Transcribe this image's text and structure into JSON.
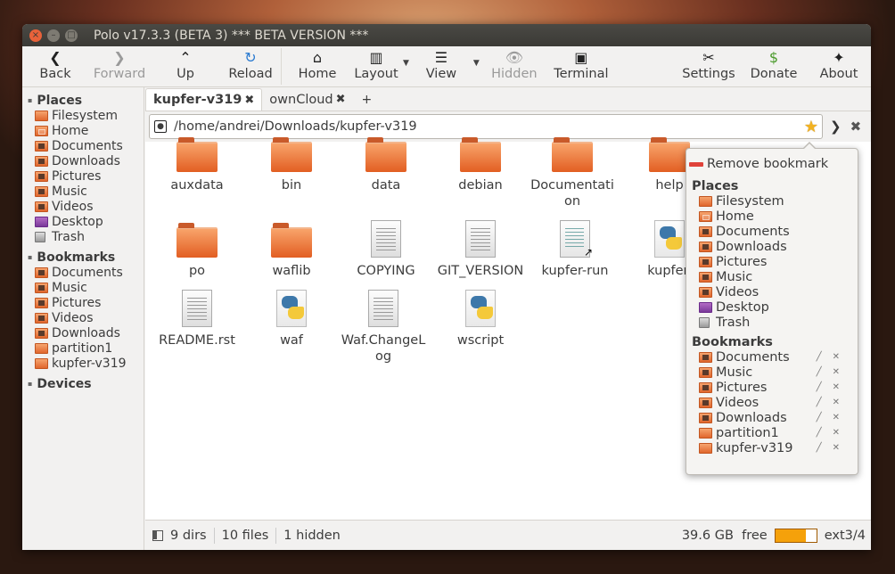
{
  "window": {
    "title": "Polo v17.3.3 (BETA 3)  *** BETA VERSION ***"
  },
  "toolbar": {
    "back": "Back",
    "forward": "Forward",
    "up": "Up",
    "reload": "Reload",
    "home": "Home",
    "layout": "Layout",
    "view": "View",
    "hidden": "Hidden",
    "terminal": "Terminal",
    "settings": "Settings",
    "donate": "Donate",
    "about": "About"
  },
  "sidebar": {
    "places_title": "Places",
    "places": [
      "Filesystem",
      "Home",
      "Documents",
      "Downloads",
      "Pictures",
      "Music",
      "Videos",
      "Desktop",
      "Trash"
    ],
    "bookmarks_title": "Bookmarks",
    "bookmarks": [
      "Documents",
      "Music",
      "Pictures",
      "Videos",
      "Downloads",
      "partition1",
      "kupfer-v319"
    ],
    "devices_title": "Devices"
  },
  "tabs": [
    {
      "label": "kupfer-v319",
      "active": true
    },
    {
      "label": "ownCloud",
      "active": false
    }
  ],
  "tab_add": "+",
  "path": {
    "value": "/home/andrei/Downloads/kupfer-v319"
  },
  "files": [
    {
      "name": "auxdata",
      "type": "folder"
    },
    {
      "name": "bin",
      "type": "folder"
    },
    {
      "name": "data",
      "type": "folder"
    },
    {
      "name": "debian",
      "type": "folder"
    },
    {
      "name": "Documentation",
      "type": "folder"
    },
    {
      "name": "help",
      "type": "folder"
    },
    {
      "name": "po",
      "type": "folder"
    },
    {
      "name": "waflib",
      "type": "folder"
    },
    {
      "name": "COPYING",
      "type": "text"
    },
    {
      "name": "GIT_VERSION",
      "type": "text"
    },
    {
      "name": "kupfer-run",
      "type": "script"
    },
    {
      "name": "kupfer.",
      "type": "python"
    },
    {
      "name": "README.rst",
      "type": "text"
    },
    {
      "name": "waf",
      "type": "python"
    },
    {
      "name": "Waf.ChangeLog",
      "type": "text"
    },
    {
      "name": "wscript",
      "type": "python"
    }
  ],
  "status": {
    "dirs": "9 dirs",
    "files": "10 files",
    "hidden": "1 hidden",
    "free": "39.6 GB  free",
    "usage_fraction": 0.75,
    "fs": "ext3/4"
  },
  "popover": {
    "remove": "Remove bookmark",
    "places_title": "Places",
    "places": [
      "Filesystem",
      "Home",
      "Documents",
      "Downloads",
      "Pictures",
      "Music",
      "Videos",
      "Desktop",
      "Trash"
    ],
    "bookmarks_title": "Bookmarks",
    "bookmarks": [
      "Documents",
      "Music",
      "Pictures",
      "Videos",
      "Downloads",
      "partition1",
      "kupfer-v319"
    ]
  },
  "colors": {
    "accent": "#e0672d",
    "star": "#f2b221",
    "usage": "#f5a10a",
    "remove": "#e0423a"
  }
}
